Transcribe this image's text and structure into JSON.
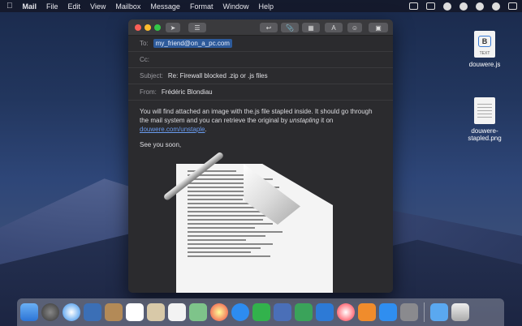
{
  "menubar": {
    "apple": "",
    "app": "Mail",
    "items": [
      "File",
      "Edit",
      "View",
      "Mailbox",
      "Message",
      "Format",
      "Window",
      "Help"
    ]
  },
  "window": {
    "to_label": "To:",
    "to_value": "my_friend@on_a_pc.com",
    "cc_label": "Cc:",
    "subject_label": "Subject:",
    "subject_value": "Re: Firewall blocked .zip or .js files",
    "from_label": "From:",
    "from_value": "Frédéric Blondiau",
    "body_line1": "You will find attached an image with the.js file stapled inside. It should go through the mail system and you can retrieve the original by ",
    "body_em": "unstapling",
    "body_line2": " it on ",
    "body_link": "douwere.com/unstaple",
    "body_end": ".",
    "signoff": "See you soon,"
  },
  "desktop": {
    "file1": "douwere.js",
    "file1_icon_letter": "B",
    "file1_icon_text": "TEXT",
    "file2": "douwere-stapled.png"
  },
  "toolbar": {
    "format_label": "A"
  }
}
